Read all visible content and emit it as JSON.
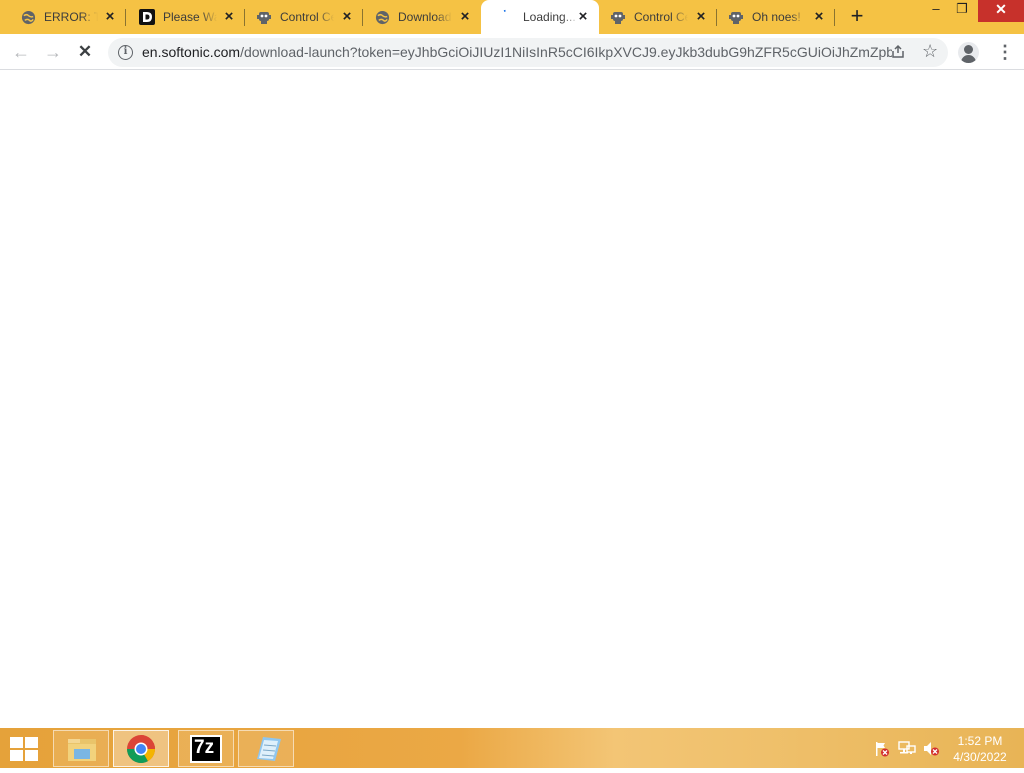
{
  "browser": {
    "tabs": [
      {
        "title": "ERROR: The",
        "icon": "globe-icon"
      },
      {
        "title": "Please Wait",
        "icon": "d-logo-icon"
      },
      {
        "title": "Control Center",
        "icon": "robot-icon"
      },
      {
        "title": "Download",
        "icon": "globe-icon"
      },
      {
        "title": "Loading...",
        "icon": "loading-spinner-icon",
        "active": true
      },
      {
        "title": "Control Center",
        "icon": "robot-icon"
      },
      {
        "title": "Oh noes!",
        "icon": "robot-icon"
      }
    ],
    "new_tab_symbol": "+",
    "close_symbol": "×",
    "window_controls": {
      "minimize": "–",
      "restore": "❐",
      "close": "✕"
    },
    "toolbar": {
      "back_symbol": "←",
      "forward_symbol": "→",
      "stop_symbol": "✕",
      "url_host": "en.softonic.com",
      "url_rest": "/download-launch?token=eyJhbGciOiJIUzI1NiIsInR5cCI6IkpXVCJ9.eyJkb3dubG9hZFR5cGUiOiJhZmZpb...",
      "info_symbol": "i",
      "share_symbol": "⇪",
      "bookmark_symbol": "☆",
      "menu_symbol": "⋮"
    }
  },
  "taskbar": {
    "pinned": [
      "file-explorer-icon",
      "chrome-icon",
      "7zip-icon",
      "notepad-icon"
    ],
    "seven_zip_label": "7z",
    "tray_icons": [
      "action-center-flag-icon",
      "network-icon",
      "volume-muted-icon"
    ],
    "clock": {
      "time": "1:52 PM",
      "date": "4/30/2022"
    },
    "colors": {
      "accent": "#f5c244",
      "taskbar": "#e9a844"
    }
  }
}
